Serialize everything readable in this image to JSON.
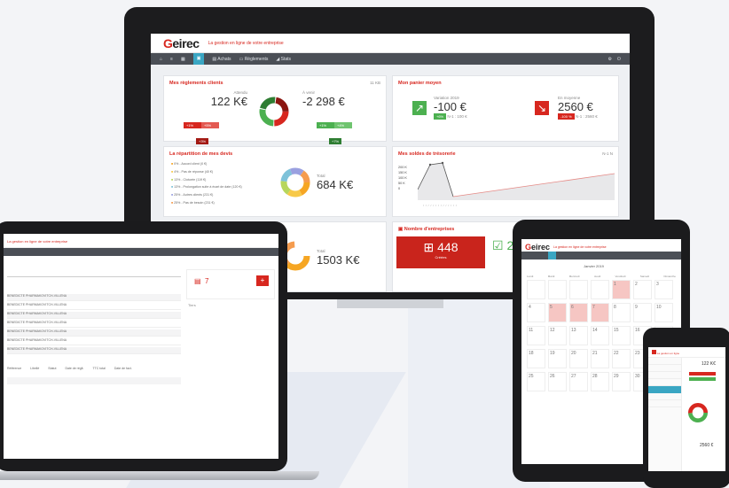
{
  "desktop": {
    "logo_letter": "G",
    "logo_rest": "eirec",
    "tagline": "La gestion en ligne de votre entreprise",
    "nav": [
      "Achats",
      "Règlements",
      "Stats"
    ],
    "cards": {
      "reglements": {
        "title": "Mes règlements clients",
        "badge": "11 KB",
        "left_label": "Attendu",
        "left_value": "122 K€",
        "right_label": "À venir",
        "right_value": "-2 298 €",
        "left_pills": [
          "+1%",
          "+5%",
          "+3%"
        ],
        "right_pills": [
          "+1%",
          "+4%",
          "+7%"
        ]
      },
      "moyen": {
        "title": "Mon panier moyen",
        "left_label": "Variation 2019",
        "left_value": "-100 €",
        "left_pct": "+6%",
        "left_sub": "N-1 : 100 €",
        "right_label": "En moyenne",
        "right_value": "2560 €",
        "right_pct": "-100 %",
        "right_sub": "N-1 : 2560 €"
      },
      "repartition": {
        "title": "La répartition de mes devis",
        "items": [
          "0% - Accord client (0 €)",
          "4% - Pas de réponse (40 €)",
          "13% - Cloturée (119 €)",
          "13% - Prolongation suite à écart de date (120 €)",
          "25% - Autres clients (231 €)",
          "25% - Pas de besoin (231 €)"
        ],
        "total_label": "Total",
        "total_value": "684 K€"
      },
      "soldes": {
        "title": "Mes soldes de trésorerie",
        "y_ticks": [
          "200 K",
          "150 K",
          "100 K",
          "50 K",
          "0"
        ],
        "legend": "N-1 N"
      },
      "total2": {
        "total_label": "Total",
        "total_value": "1503 K€"
      },
      "entreprise": {
        "title": "Nombre d'entreprises",
        "red_value": "448",
        "red_label": "Créées",
        "green_value": "2"
      }
    }
  },
  "laptop": {
    "tagline": "La gestion en ligne de votre entreprise",
    "rows": [
      "BENEDICTE PHARMAKOVITCH-VILLENA",
      "BENEDICTE PHARMAKOVITCH-VILLENA",
      "BENEDICTE PHARMAKOVITCH-VILLENA",
      "BENEDICTE PHARMAKOVITCH-VILLENA",
      "BENEDICTE PHARMAKOVITCH-VILLENA",
      "BENEDICTE PHARMAKOVITCH-VILLENA",
      "BENEDICTE PHARMAKOVITCH-VILLENA"
    ],
    "side_label": "Tiers",
    "side_value": "7",
    "bottom_headers": [
      "Référence",
      "Libellé",
      "Statut",
      "Date de réglt.",
      "TTC total",
      "Date de fact."
    ]
  },
  "tablet": {
    "logo_letter": "G",
    "logo_rest": "eirec",
    "tagline": "La gestion en ligne de votre entreprise",
    "month": "Janvier 2019",
    "days": [
      "Lundi",
      "Mardi",
      "Mercredi",
      "Jeudi",
      "Vendredi",
      "Samedi",
      "Dimanche"
    ],
    "dates": [
      "",
      "",
      "",
      "",
      "1",
      "2",
      "3",
      "4",
      "5",
      "6",
      "7",
      "8",
      "9",
      "10",
      "11",
      "12",
      "13",
      "14",
      "15",
      "16",
      "17",
      "18",
      "19",
      "20",
      "21",
      "22",
      "23",
      "24",
      "25",
      "26",
      "27",
      "28",
      "29",
      "30",
      "31"
    ]
  },
  "phone": {
    "tagline": "La gestion en ligne",
    "value": "122 K€",
    "value2": "2560 €"
  },
  "colors": {
    "brand_red": "#d7271f",
    "accent_blue": "#3aa6c3",
    "green": "#4cb050",
    "nav_dark": "#4b4f56"
  }
}
